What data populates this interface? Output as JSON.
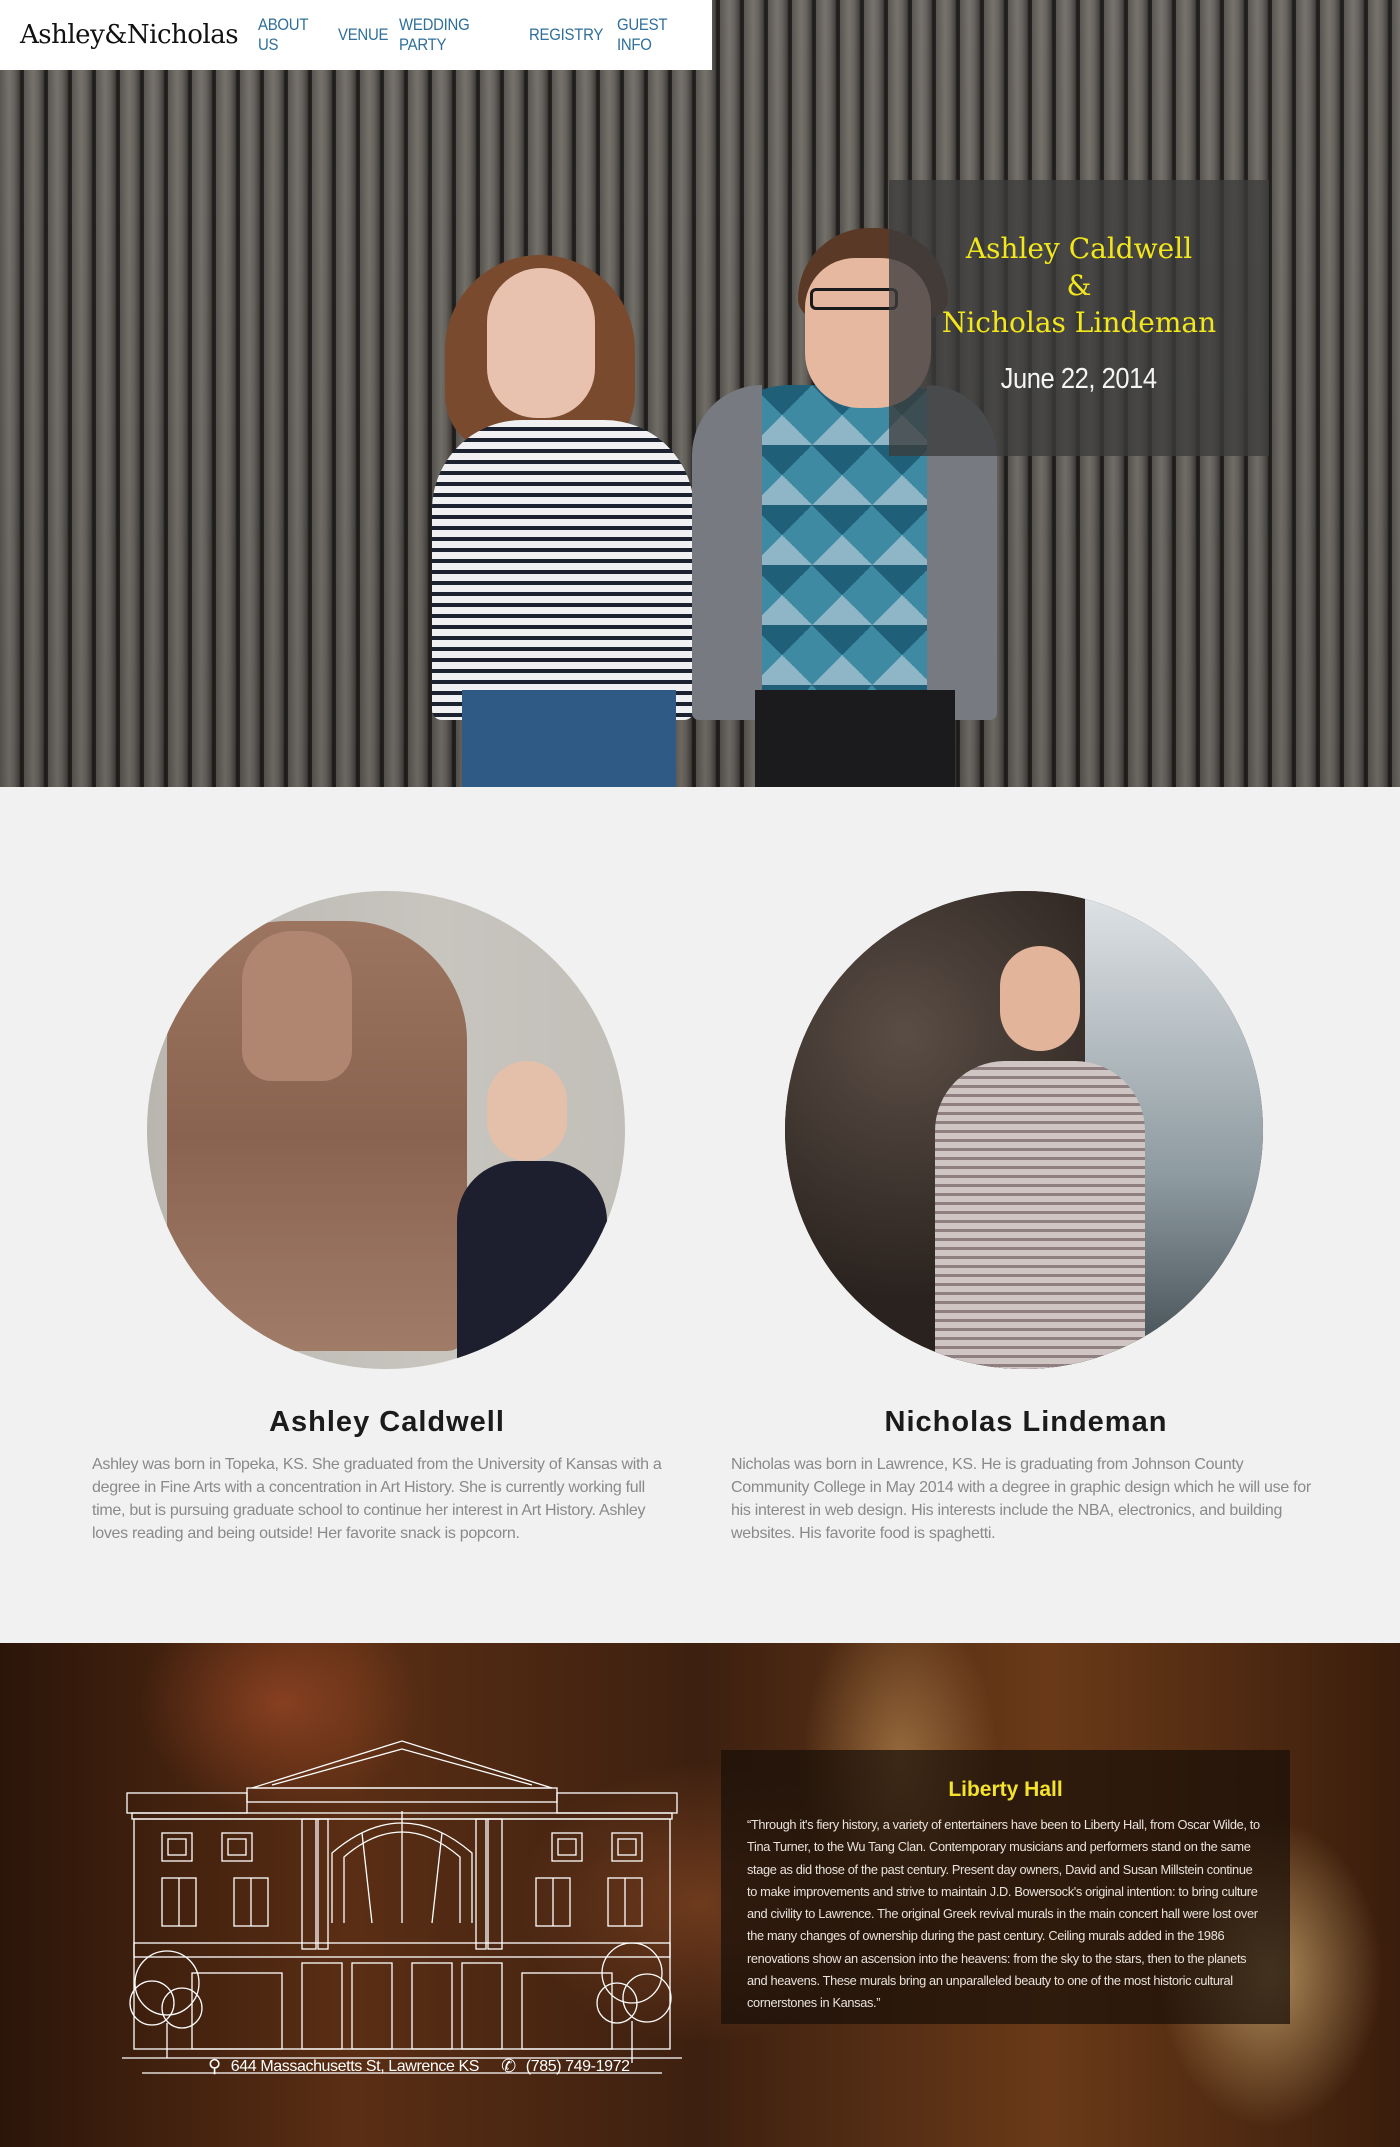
{
  "nav": {
    "logo": "Ashley&Nicholas",
    "links": [
      "ABOUT US",
      "VENUE",
      "WEDDING PARTY",
      "REGISTRY",
      "GUEST INFO"
    ]
  },
  "hero": {
    "bride": "Ashley Caldwell",
    "ampersand": "&",
    "groom": "Nicholas Lindeman",
    "date": "June 22, 2014"
  },
  "about": {
    "ashley": {
      "name": "Ashley Caldwell",
      "bio": "Ashley was born in Topeka, KS. She graduated from the University of Kansas with a degree in Fine Arts with a concentration in Art History. She is currently working full time, but is pursuing graduate school to continue her interest in Art History. Ashley loves reading and being outside! Her favorite snack is popcorn."
    },
    "nicholas": {
      "name": "Nicholas Lindeman",
      "bio": "Nicholas was born in Lawrence, KS. He is graduating from Johnson County Community College in May 2014 with a degree in graphic design which he will use for his interest in web design. His interests include the NBA, electronics, and building websites. His favorite food is spaghetti."
    }
  },
  "venue": {
    "title": "Liberty Hall",
    "description": "“Through it's fiery history, a variety of entertainers have been to Liberty Hall, from Oscar Wilde, to Tina Turner, to the Wu Tang Clan. Contemporary musicians and performers stand on the same stage as did those of the past century. Present day owners, David and Susan Millstein continue to make improvements and strive to maintain J.D. Bowersock's original intention: to bring culture and civility to Lawrence. The original Greek revival murals in the main concert hall were lost over the many changes of ownership during the past century. Ceiling murals added in the 1986 renovations show an ascension into the heavens: from the sky to the stars, then to the planets and heavens. These murals bring an unparalleled beauty to one of the most historic cultural cornerstones in Kansas.”",
    "address": "644 Massachusetts St, Lawrence KS",
    "phone": "(785) 749-1972",
    "icons": {
      "address": "map-pin-icon",
      "phone": "phone-icon"
    }
  },
  "colors": {
    "accent_yellow": "#f2e71a",
    "nav_blue": "#2f6f9a",
    "section_bg": "#f1f1f1"
  }
}
